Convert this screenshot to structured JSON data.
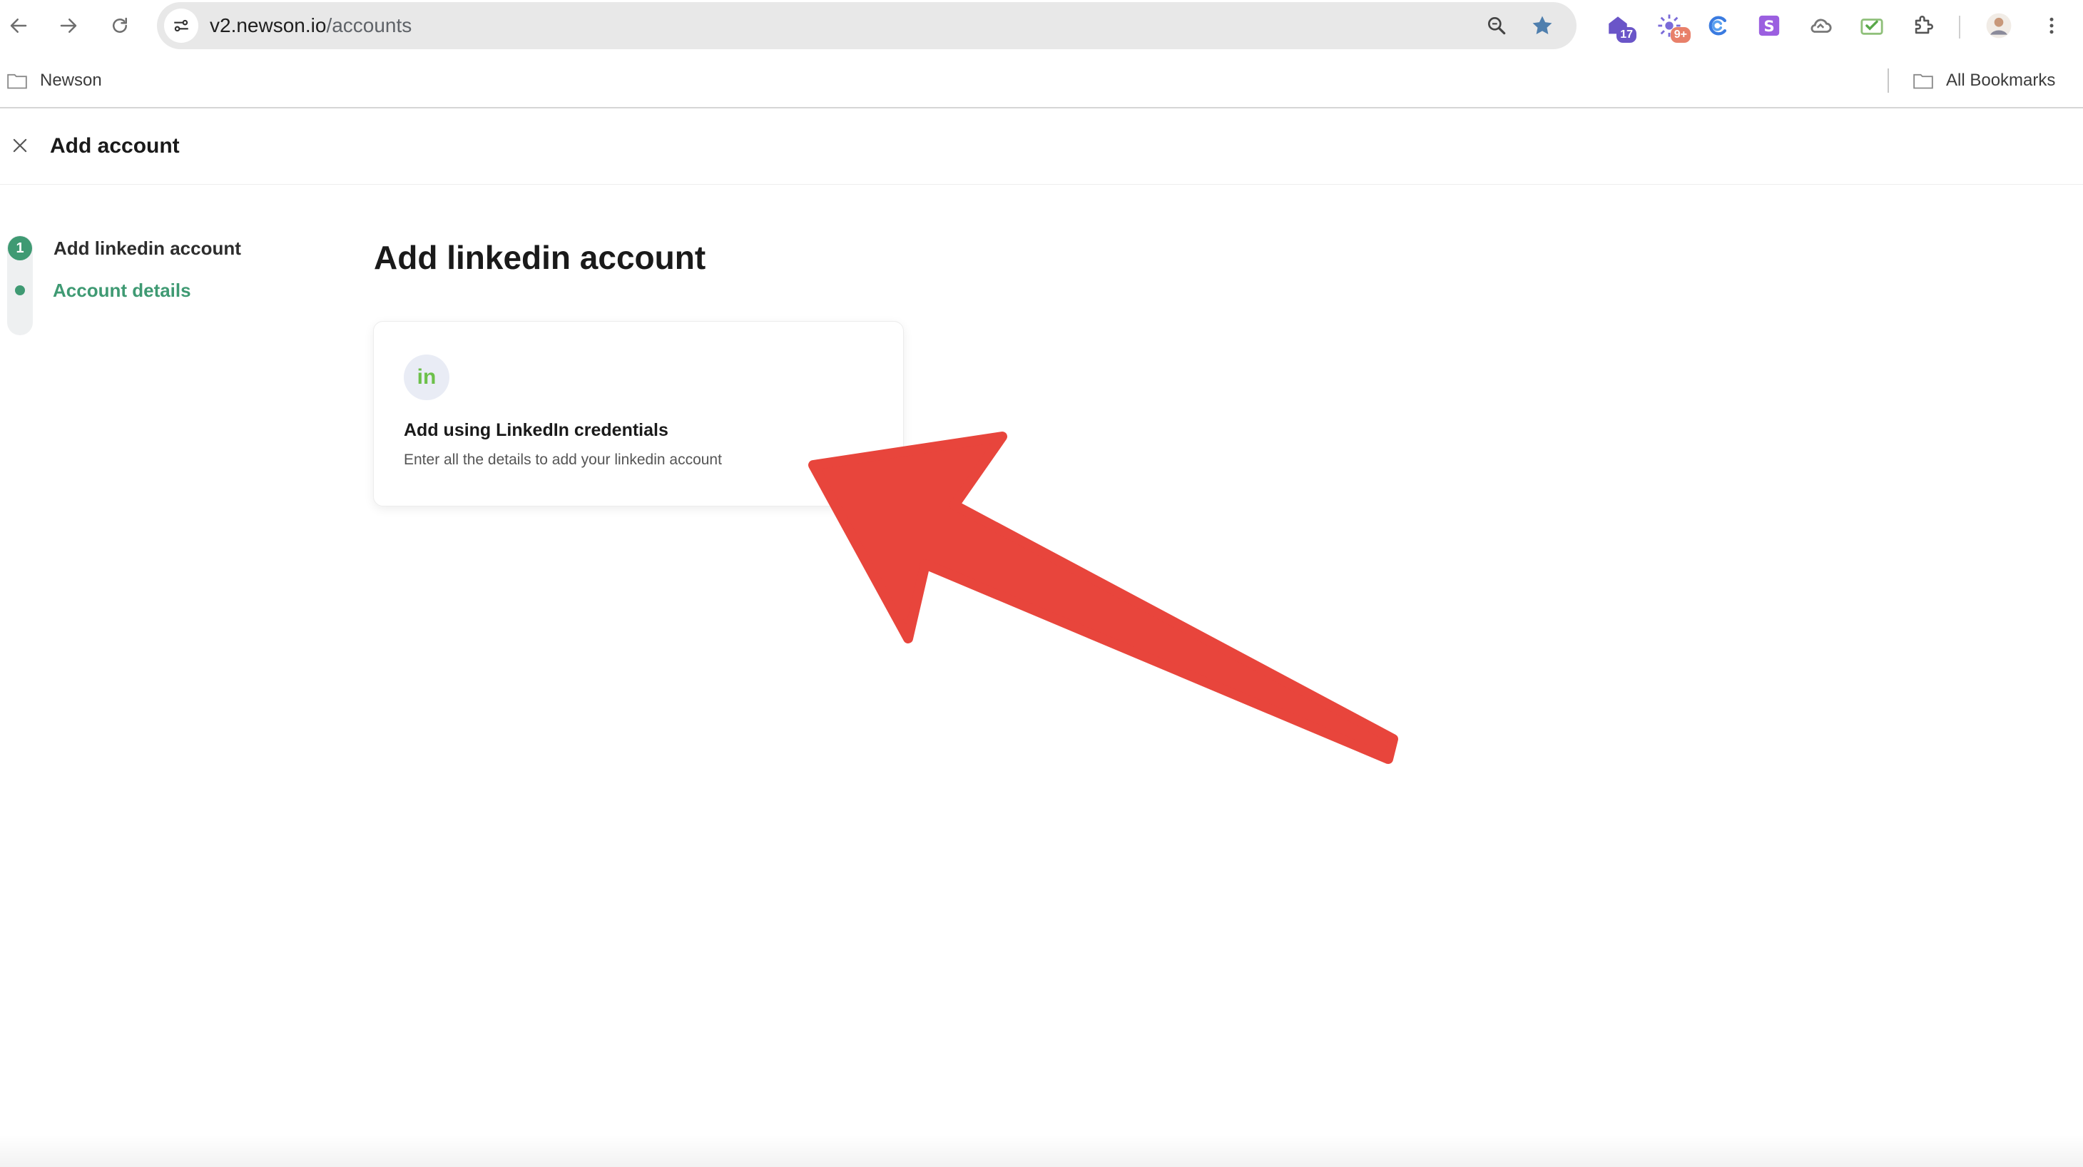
{
  "browser": {
    "url_host": "v2.newson.io",
    "url_path": "/accounts",
    "extensions": [
      {
        "name": "calendar-extension-icon",
        "badge": "17",
        "badge_color": "#6a55c8"
      },
      {
        "name": "sparkle-extension-icon",
        "badge": "9+",
        "badge_color": "#e8806a"
      },
      {
        "name": "grammar-extension-icon",
        "badge": ""
      },
      {
        "name": "s-extension-icon",
        "badge": "",
        "letter": "S"
      },
      {
        "name": "cloud-extension-icon",
        "badge": ""
      },
      {
        "name": "mail-check-extension-icon",
        "badge": ""
      }
    ],
    "accent": "#5b8db8"
  },
  "bookmarks": {
    "folder_left": "Newson",
    "folder_right": "All Bookmarks"
  },
  "app": {
    "header_title": "Add account",
    "steps": [
      {
        "number": "1",
        "label": "Add linkedin account"
      },
      {
        "label": "Account details"
      }
    ],
    "accent": "#3f9a73"
  },
  "main": {
    "title": "Add linkedin account",
    "option": {
      "logo_text": "in",
      "title": "Add using LinkedIn credentials",
      "description": "Enter all the details to add your linkedin account"
    }
  },
  "annotation": {
    "arrow_color": "#e8453c"
  }
}
